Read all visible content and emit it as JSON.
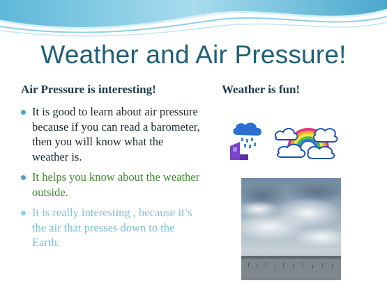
{
  "slide": {
    "title": "Weather and Air Pressure!",
    "left_heading": "Air Pressure is interesting!",
    "right_heading": "Weather is fun!",
    "bullets": [
      "It is good to learn about air pressure because if you can read a barometer, then you will know what the weather is.",
      "It helps you know about the weather outside.",
      "It is really interesting , because it’s the air that presses down to the Earth."
    ]
  },
  "colors": {
    "title": "#1f5f78",
    "bullet1": "#1b2b36",
    "bullet2": "#3d8a2e",
    "bullet3": "#7cc0d8"
  },
  "icons": [
    "wave-header-icon",
    "rain-cloud-icon",
    "rainbow-clouds-icon",
    "cloudy-sky-photo"
  ]
}
